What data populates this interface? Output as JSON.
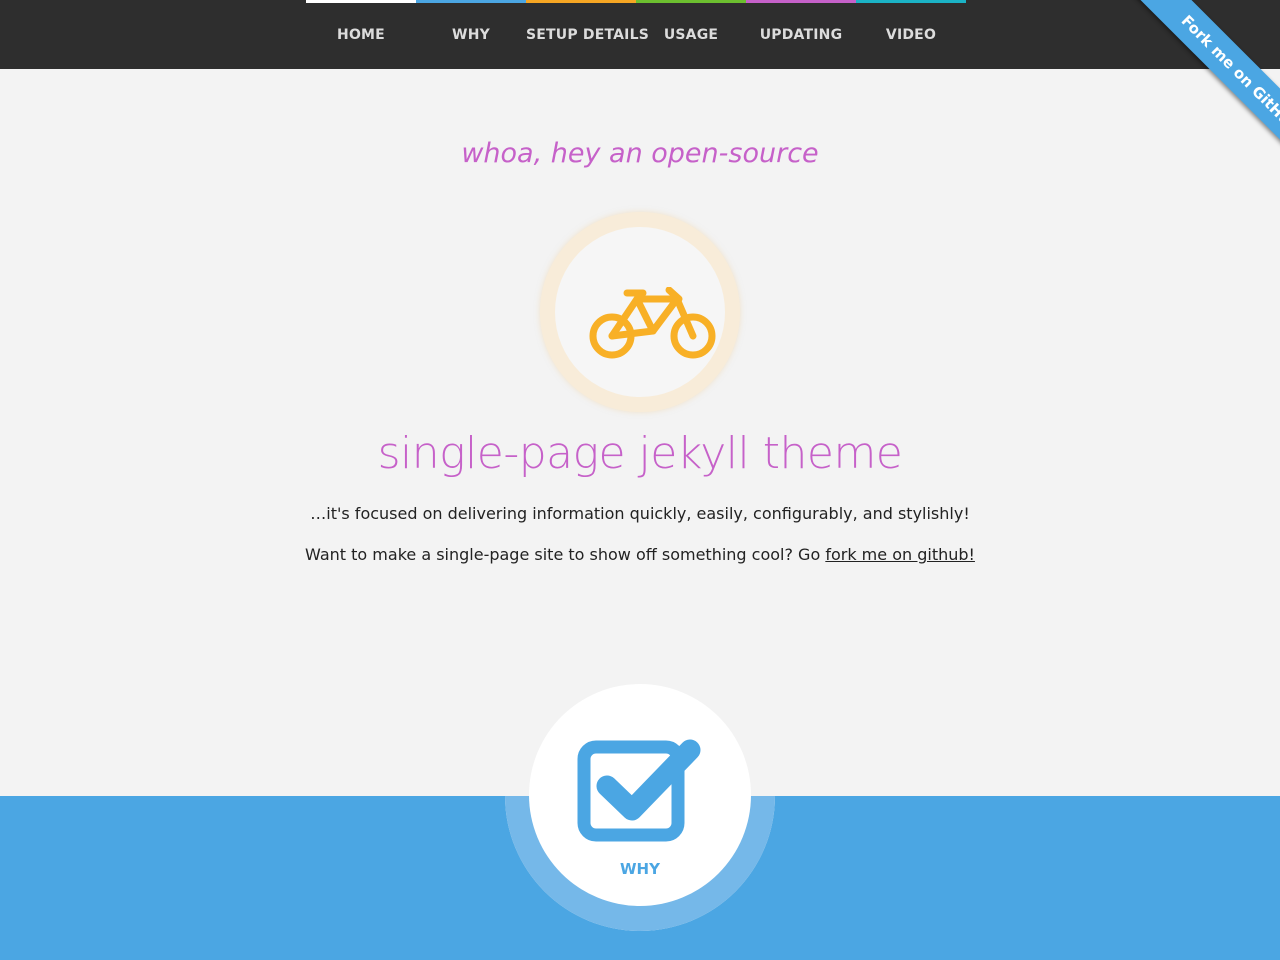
{
  "nav": {
    "items": [
      {
        "label": "HOME",
        "color": "#ffffff"
      },
      {
        "label": "WHY",
        "color": "#4ba6e3"
      },
      {
        "label": "SETUP DETAILS",
        "color": "#f6a623"
      },
      {
        "label": "USAGE",
        "color": "#6cbf2f"
      },
      {
        "label": "UPDATING",
        "color": "#c661c9"
      },
      {
        "label": "VIDEO",
        "color": "#1bb3c6"
      }
    ]
  },
  "ribbon": {
    "label": "Fork me on GitHub",
    "color": "#4ba6e3"
  },
  "hero": {
    "kicker": "whoa, hey an open-source",
    "icon": "bicycle-icon",
    "title": "single-page jekyll theme",
    "tagline": "…it's focused on delivering information quickly, easily, configurably, and stylishly!",
    "cta_prefix": "Want to make a single-page site to show off something cool? Go ",
    "cta_link": "fork me on github!",
    "accent": "#c661c9",
    "icon_color": "#f8b026"
  },
  "why": {
    "icon": "checkbox-icon",
    "label": "WHY",
    "color": "#4ba6e3"
  }
}
